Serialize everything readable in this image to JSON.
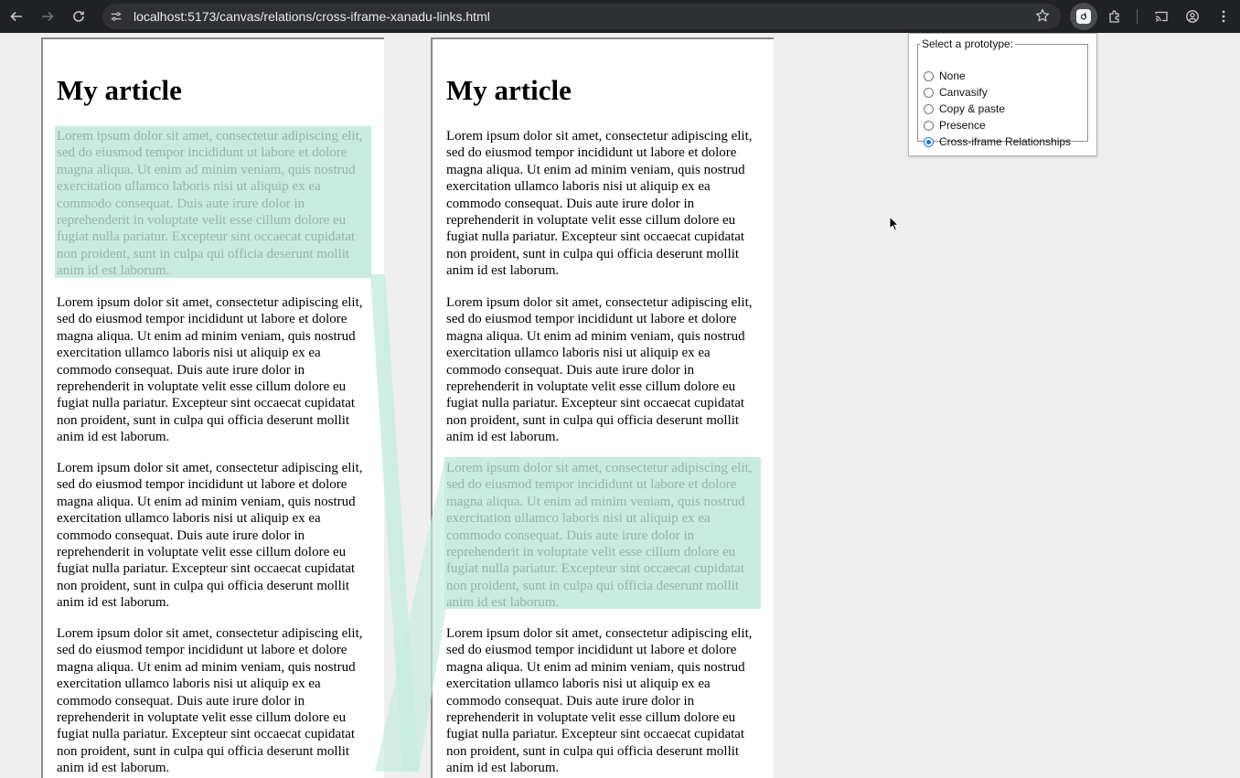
{
  "browser": {
    "url": "localhost:5173/canvas/relations/cross-iframe-xanadu-links.html",
    "icons": [
      "back-arrow-icon",
      "forward-arrow-icon",
      "reload-icon",
      "site-info-icon",
      "bookmark-star-icon",
      "extension-active-icon",
      "puzzle-extensions-icon",
      "cast-icon",
      "profile-icon",
      "more-menu-icon"
    ]
  },
  "left_panel": {
    "title": "My article",
    "paragraphs": [
      "Lorem ipsum dolor sit amet, consectetur adipiscing elit, sed do eiusmod tempor incididunt ut labore et dolore magna aliqua. Ut enim ad minim veniam, quis nostrud exercitation ullamco laboris nisi ut aliquip ex ea commodo consequat. Duis aute irure dolor in reprehenderit in voluptate velit esse cillum dolore eu fugiat nulla pariatur. Excepteur sint occaecat cupidatat non proident, sunt in culpa qui officia deserunt mollit anim id est laborum.",
      "Lorem ipsum dolor sit amet, consectetur adipiscing elit, sed do eiusmod tempor incididunt ut labore et dolore magna aliqua. Ut enim ad minim veniam, quis nostrud exercitation ullamco laboris nisi ut aliquip ex ea commodo consequat. Duis aute irure dolor in reprehenderit in voluptate velit esse cillum dolore eu fugiat nulla pariatur. Excepteur sint occaecat cupidatat non proident, sunt in culpa qui officia deserunt mollit anim id est laborum.",
      "Lorem ipsum dolor sit amet, consectetur adipiscing elit, sed do eiusmod tempor incididunt ut labore et dolore magna aliqua. Ut enim ad minim veniam, quis nostrud exercitation ullamco laboris nisi ut aliquip ex ea commodo consequat. Duis aute irure dolor in reprehenderit in voluptate velit esse cillum dolore eu fugiat nulla pariatur. Excepteur sint occaecat cupidatat non proident, sunt in culpa qui officia deserunt mollit anim id est laborum.",
      "Lorem ipsum dolor sit amet, consectetur adipiscing elit, sed do eiusmod tempor incididunt ut labore et dolore magna aliqua. Ut enim ad minim veniam, quis nostrud exercitation ullamco laboris nisi ut aliquip ex ea commodo consequat. Duis aute irure dolor in reprehenderit in voluptate velit esse cillum dolore eu fugiat nulla pariatur. Excepteur sint occaecat cupidatat non proident, sunt in culpa qui officia deserunt mollit anim id est laborum."
    ],
    "highlighted_paragraph_index": 0
  },
  "right_panel": {
    "title": "My article",
    "paragraphs": [
      "Lorem ipsum dolor sit amet, consectetur adipiscing elit, sed do eiusmod tempor incididunt ut labore et dolore magna aliqua. Ut enim ad minim veniam, quis nostrud exercitation ullamco laboris nisi ut aliquip ex ea commodo consequat. Duis aute irure dolor in reprehenderit in voluptate velit esse cillum dolore eu fugiat nulla pariatur. Excepteur sint occaecat cupidatat non proident, sunt in culpa qui officia deserunt mollit anim id est laborum.",
      "Lorem ipsum dolor sit amet, consectetur adipiscing elit, sed do eiusmod tempor incididunt ut labore et dolore magna aliqua. Ut enim ad minim veniam, quis nostrud exercitation ullamco laboris nisi ut aliquip ex ea commodo consequat. Duis aute irure dolor in reprehenderit in voluptate velit esse cillum dolore eu fugiat nulla pariatur. Excepteur sint occaecat cupidatat non proident, sunt in culpa qui officia deserunt mollit anim id est laborum.",
      "Lorem ipsum dolor sit amet, consectetur adipiscing elit, sed do eiusmod tempor incididunt ut labore et dolore magna aliqua. Ut enim ad minim veniam, quis nostrud exercitation ullamco laboris nisi ut aliquip ex ea commodo consequat. Duis aute irure dolor in reprehenderit in voluptate velit esse cillum dolore eu fugiat nulla pariatur. Excepteur sint occaecat cupidatat non proident, sunt in culpa qui officia deserunt mollit anim id est laborum.",
      "Lorem ipsum dolor sit amet, consectetur adipiscing elit, sed do eiusmod tempor incididunt ut labore et dolore magna aliqua. Ut enim ad minim veniam, quis nostrud exercitation ullamco laboris nisi ut aliquip ex ea commodo consequat. Duis aute irure dolor in reprehenderit in voluptate velit esse cillum dolore eu fugiat nulla pariatur. Excepteur sint occaecat cupidatat non proident, sunt in culpa qui officia deserunt mollit anim id est laborum."
    ],
    "highlighted_paragraph_index": 2
  },
  "prototype_selector": {
    "legend": "Select a prototype:",
    "options": [
      {
        "label": "None",
        "checked": false
      },
      {
        "label": "Canvasify",
        "checked": false
      },
      {
        "label": "Copy & paste",
        "checked": false
      },
      {
        "label": "Presence",
        "checked": false
      },
      {
        "label": "Cross-iframe Relationships",
        "checked": true
      }
    ]
  },
  "colors": {
    "highlight": "#c8ece0",
    "highlight_text": "#9ab2a8",
    "link_band": "#c8ece0",
    "radio_checked": "#1a73e8"
  }
}
